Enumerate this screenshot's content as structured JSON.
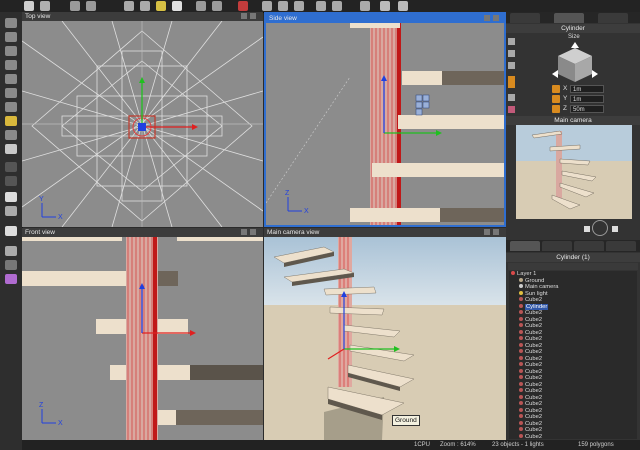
{
  "viewports": {
    "top": {
      "title": "Top view",
      "axis_x": "X",
      "axis_y": "Y"
    },
    "side": {
      "title": "Side view",
      "axis_x": "X",
      "axis_y": "Z"
    },
    "front": {
      "title": "Front view",
      "axis_x": "X",
      "axis_y": "Z"
    },
    "main": {
      "title": "Main camera view",
      "tooltip": "Ground"
    }
  },
  "panel": {
    "object_title": "Cylinder",
    "size_label": "Size",
    "fields": [
      {
        "axis": "X",
        "value": "1m"
      },
      {
        "axis": "Y",
        "value": "1m"
      },
      {
        "axis": "Z",
        "value": "50m"
      }
    ],
    "preview_title": "Main camera",
    "tree_title": "Cylinder (1)",
    "tree_items": [
      {
        "label": "Layer 1",
        "kind": "layer"
      },
      {
        "label": "Ground",
        "kind": "ground"
      },
      {
        "label": "Main camera",
        "kind": "camera"
      },
      {
        "label": "Sun light",
        "kind": "light"
      },
      {
        "label": "Cube2",
        "kind": "cube"
      },
      {
        "label": "Cylinder",
        "kind": "cylinder",
        "selected": true
      },
      {
        "label": "Cube2",
        "kind": "cube"
      },
      {
        "label": "Cube2",
        "kind": "cube"
      },
      {
        "label": "Cube2",
        "kind": "cube"
      },
      {
        "label": "Cube2",
        "kind": "cube"
      },
      {
        "label": "Cube2",
        "kind": "cube"
      },
      {
        "label": "Cube2",
        "kind": "cube"
      },
      {
        "label": "Cube2",
        "kind": "cube"
      },
      {
        "label": "Cube2",
        "kind": "cube"
      },
      {
        "label": "Cube2",
        "kind": "cube"
      },
      {
        "label": "Cube2",
        "kind": "cube"
      },
      {
        "label": "Cube2",
        "kind": "cube"
      },
      {
        "label": "Cube2",
        "kind": "cube"
      },
      {
        "label": "Cube2",
        "kind": "cube"
      },
      {
        "label": "Cube2",
        "kind": "cube"
      },
      {
        "label": "Cube2",
        "kind": "cube"
      },
      {
        "label": "Cube2",
        "kind": "cube"
      },
      {
        "label": "Cube2",
        "kind": "cube"
      },
      {
        "label": "Cube2",
        "kind": "cube"
      },
      {
        "label": "Cube2",
        "kind": "cube"
      },
      {
        "label": "Cube2",
        "kind": "cube"
      }
    ]
  },
  "status": {
    "cpu": "1CPU",
    "zoom": "Zoom : 614%",
    "objects": "23 objects - 1 lights",
    "polygons": "159 polygons"
  },
  "colors": {
    "accent": "#2f6ed0",
    "viewport": "#8c8c8c",
    "axis_x": "#e02020",
    "axis_y": "#20c020",
    "axis_z": "#2040e0"
  }
}
